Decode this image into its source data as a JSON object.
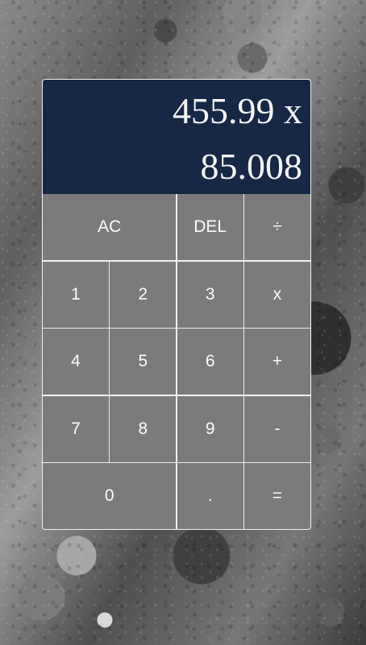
{
  "display": {
    "previous": "455.99 x",
    "current": "85.008"
  },
  "keys": {
    "ac": "AC",
    "del": "DEL",
    "divide": "÷",
    "one": "1",
    "two": "2",
    "three": "3",
    "multiply": "x",
    "four": "4",
    "five": "5",
    "six": "6",
    "plus": "+",
    "seven": "7",
    "eight": "8",
    "nine": "9",
    "minus": "-",
    "zero": "0",
    "decimal": ".",
    "equals": "="
  }
}
